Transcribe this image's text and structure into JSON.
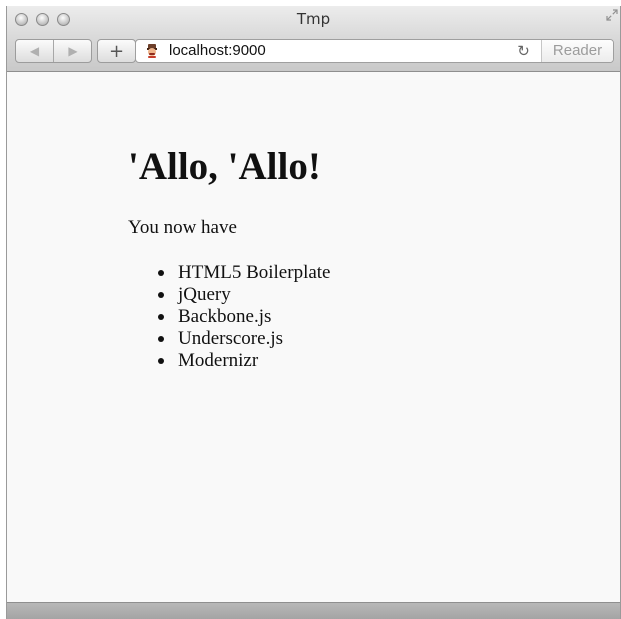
{
  "browser": {
    "window_title": "Tmp",
    "url": "localhost:9000",
    "reader_label": "Reader",
    "icons": {
      "close": "close-icon",
      "minimize": "minimize-icon",
      "zoom": "zoom-icon",
      "fullscreen": "fullscreen-icon",
      "back": "back-icon",
      "forward": "forward-icon",
      "new_tab": "plus-icon",
      "site": "yeoman-icon",
      "refresh": "refresh-icon"
    }
  },
  "page": {
    "heading": "'Allo, 'Allo!",
    "intro": "You now have",
    "items": [
      "HTML5 Boilerplate",
      "jQuery",
      "Backbone.js",
      "Underscore.js",
      "Modernizr"
    ]
  },
  "colors": {
    "page_background": "#f9f9f9",
    "chrome_gray": "#d7d7d7",
    "text": "#111111"
  }
}
